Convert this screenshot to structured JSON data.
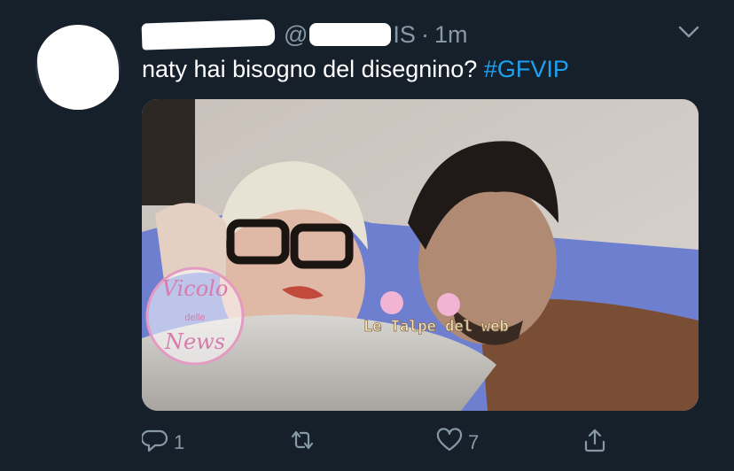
{
  "tweet": {
    "handle_prefix": "@",
    "handle_suffix": "IS",
    "separator": "·",
    "time": "1m",
    "text_main": "naty hai bisogno del disegnino?",
    "hashtag": "#GFVIP"
  },
  "media": {
    "watermark_left_line1": "Vicolo",
    "watermark_left_line2": "delle",
    "watermark_left_line3": "News",
    "watermark_center": "Le Talpe del web"
  },
  "actions": {
    "reply_count": "1",
    "retweet_count": "",
    "like_count": "7"
  },
  "icons": {
    "caret": "chevron-down-icon",
    "reply": "reply-icon",
    "retweet": "retweet-icon",
    "like": "heart-icon",
    "share": "share-icon"
  },
  "colors": {
    "background": "#15202b",
    "secondary_text": "#8899a6",
    "hashtag": "#1da1f2"
  }
}
